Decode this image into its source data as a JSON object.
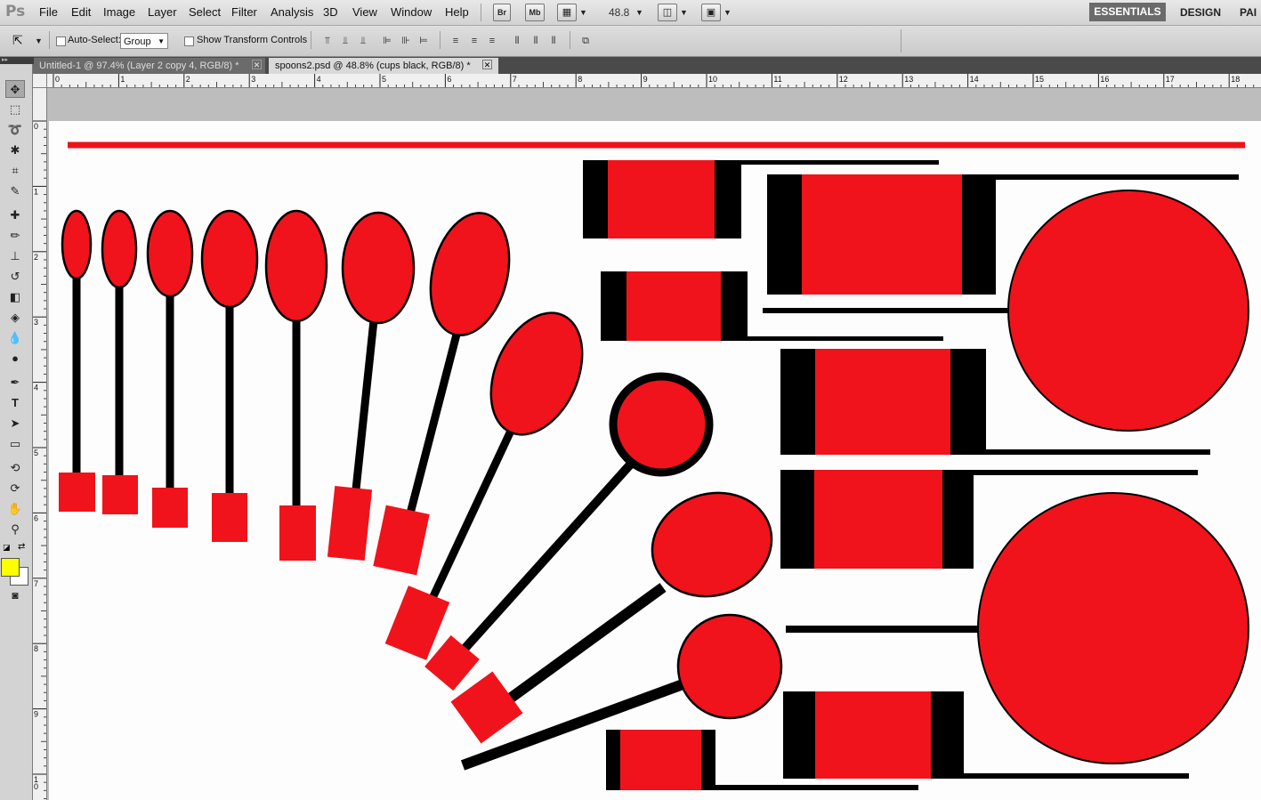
{
  "app": {
    "logo": "Ps"
  },
  "menu": [
    "File",
    "Edit",
    "Image",
    "Layer",
    "Select",
    "Filter",
    "Analysis",
    "3D",
    "View",
    "Window",
    "Help"
  ],
  "app_bar": {
    "bridge": "Br",
    "mini_bridge": "Mb",
    "zoom": "48.8"
  },
  "workspaces": {
    "active": "ESSENTIALS",
    "design": "DESIGN",
    "painting": "PAI"
  },
  "options": {
    "auto_select_label": "Auto-Select:",
    "auto_select_checked": false,
    "auto_select_target": "Group",
    "show_transform_label": "Show Transform Controls",
    "show_transform_checked": false
  },
  "tabs": [
    {
      "title": "Untitled-1 @ 97.4% (Layer 2 copy 4, RGB/8) *",
      "active": false
    },
    {
      "title": "spoons2.psd @ 48.8% (cups black, RGB/8) *",
      "active": true
    }
  ],
  "ruler": {
    "horizontal": [
      "0",
      "1",
      "2",
      "3",
      "4",
      "5",
      "6",
      "7",
      "8",
      "9",
      "10",
      "11",
      "12",
      "13",
      "14",
      "15",
      "16",
      "17",
      "18"
    ],
    "vertical": [
      "0",
      "1",
      "2",
      "3",
      "4",
      "5",
      "6",
      "7",
      "8",
      "9",
      "1 0"
    ]
  },
  "colors": {
    "foreground": "#FFFF00",
    "background": "#FFFFFF",
    "art_red": "#F0131B",
    "art_black": "#000000"
  },
  "tools": [
    "move-icon",
    "marquee-icon",
    "lasso-icon",
    "quick-select-icon",
    "crop-icon",
    "eyedropper-icon",
    "healing-icon",
    "brush-icon",
    "clone-stamp-icon",
    "history-brush-icon",
    "eraser-icon",
    "paint-bucket-icon",
    "blur-icon",
    "dodge-icon",
    "pen-icon",
    "type-icon",
    "path-select-icon",
    "rectangle-icon",
    "3d-rotate-icon",
    "3d-orbit-icon",
    "hand-icon",
    "zoom-icon",
    "quick-mask-icon"
  ]
}
